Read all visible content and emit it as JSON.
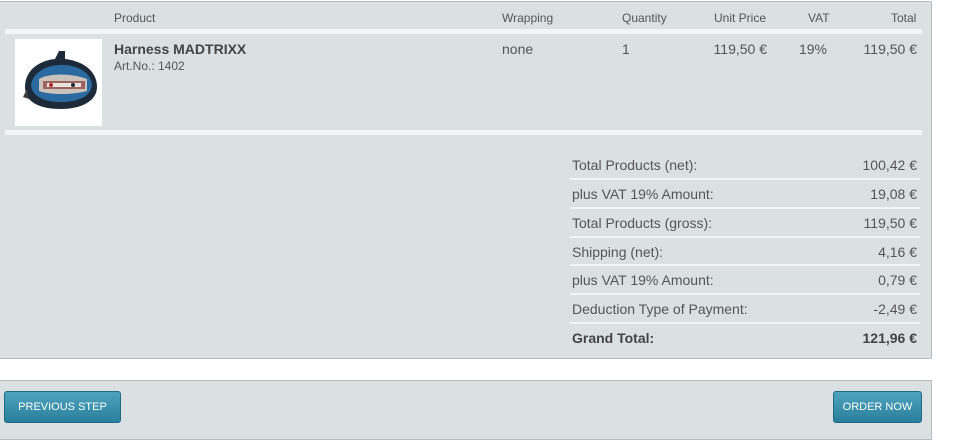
{
  "table": {
    "headers": {
      "product": "Product",
      "wrapping": "Wrapping",
      "quantity": "Quantity",
      "unit_price": "Unit Price",
      "vat": "VAT",
      "total": "Total"
    },
    "item": {
      "name": "Harness MADTRIXX",
      "article": "Art.No.: 1402",
      "wrapping": "none",
      "quantity": "1",
      "unit_price": "119,50 €",
      "vat": "19%",
      "total": "119,50 €",
      "image_icon": "harness-product-image"
    }
  },
  "summary": [
    {
      "label": "Total Products (net):",
      "value": "100,42 €"
    },
    {
      "label": "plus VAT 19% Amount:",
      "value": "19,08 €"
    },
    {
      "label": "Total Products (gross):",
      "value": "119,50 €"
    },
    {
      "label": "Shipping (net):",
      "value": "4,16 €"
    },
    {
      "label": "plus VAT 19% Amount:",
      "value": "0,79 €"
    },
    {
      "label": "Deduction Type of Payment:",
      "value": "-2,49 €"
    }
  ],
  "grand_total": {
    "label": "Grand Total:",
    "value": "121,96 €"
  },
  "buttons": {
    "previous": "PREVIOUS STEP",
    "order": "ORDER NOW"
  },
  "colors": {
    "panel_bg": "#dbe0e3",
    "button": "#2a7f9c"
  }
}
